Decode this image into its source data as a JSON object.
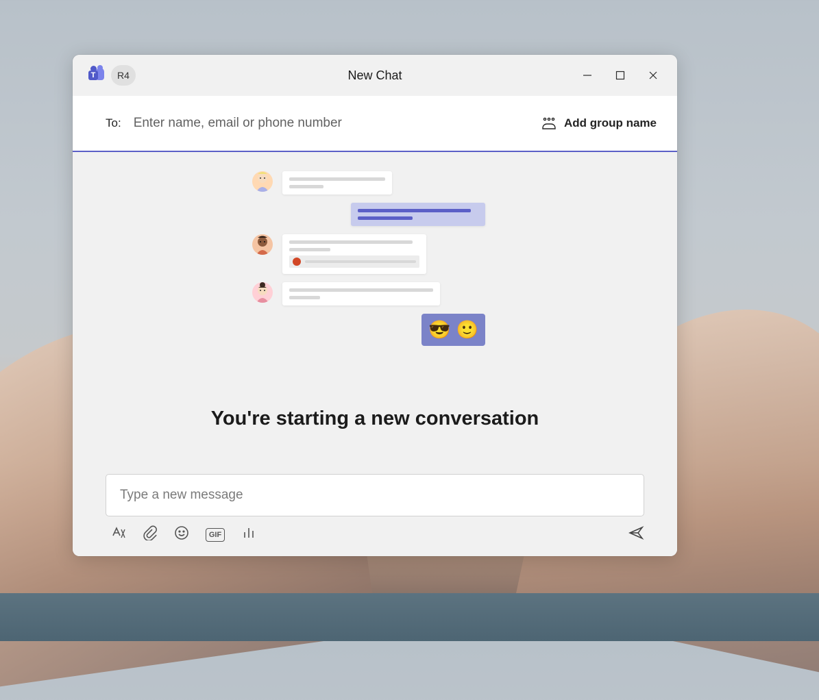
{
  "titlebar": {
    "user_initials": "R4",
    "title": "New Chat"
  },
  "to_bar": {
    "label": "To:",
    "placeholder": "Enter name, email or phone number",
    "add_group_label": "Add group name"
  },
  "content": {
    "heading": "You're starting a new conversation",
    "emoji_1": "😎",
    "emoji_2": "🙂"
  },
  "compose": {
    "placeholder": "Type a new message",
    "gif_label": "GIF"
  },
  "icons": {
    "format": "format-text-icon",
    "attach": "attach-icon",
    "emoji": "emoji-icon",
    "gif": "gif-icon",
    "poll": "poll-icon",
    "send": "send-icon",
    "minimize": "minimize-icon",
    "maximize": "maximize-icon",
    "close": "close-icon",
    "group": "people-group-icon",
    "teams": "teams-app-icon"
  }
}
